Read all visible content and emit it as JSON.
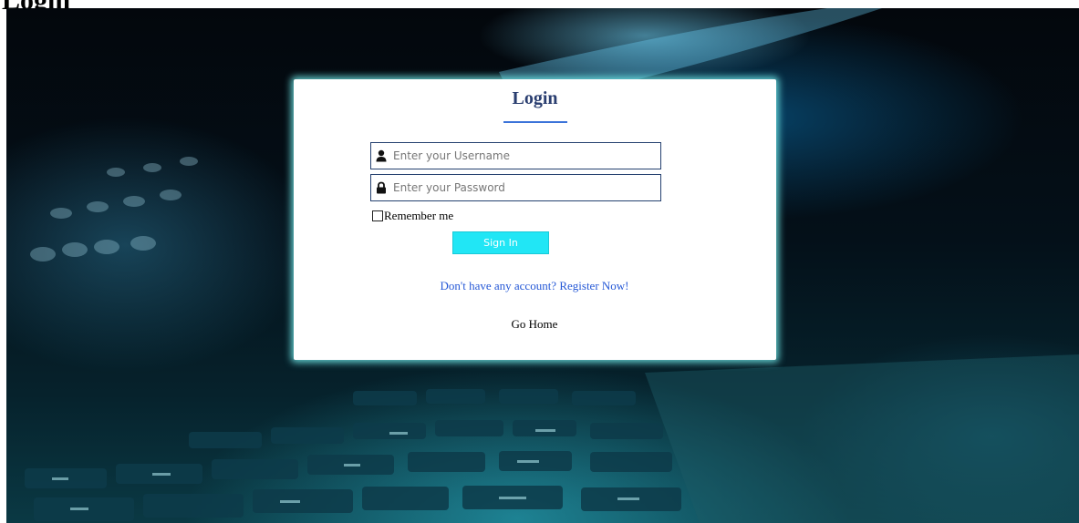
{
  "page": {
    "heading": "Login"
  },
  "login_form": {
    "title": "Login",
    "username": {
      "placeholder": "Enter your Username",
      "value": "",
      "icon": "user-icon"
    },
    "password": {
      "placeholder": "Enter your Password",
      "value": "",
      "icon": "lock-icon"
    },
    "remember_label": "Remember me",
    "remember_checked": false,
    "sign_in_label": "Sign In",
    "register_link": "Don't have any account? Register Now!",
    "home_link": "Go Home"
  },
  "colors": {
    "accent": "#21e6f5",
    "title": "#2a3e70",
    "link": "#2558d6",
    "card_glow": "#6ee6e6"
  }
}
